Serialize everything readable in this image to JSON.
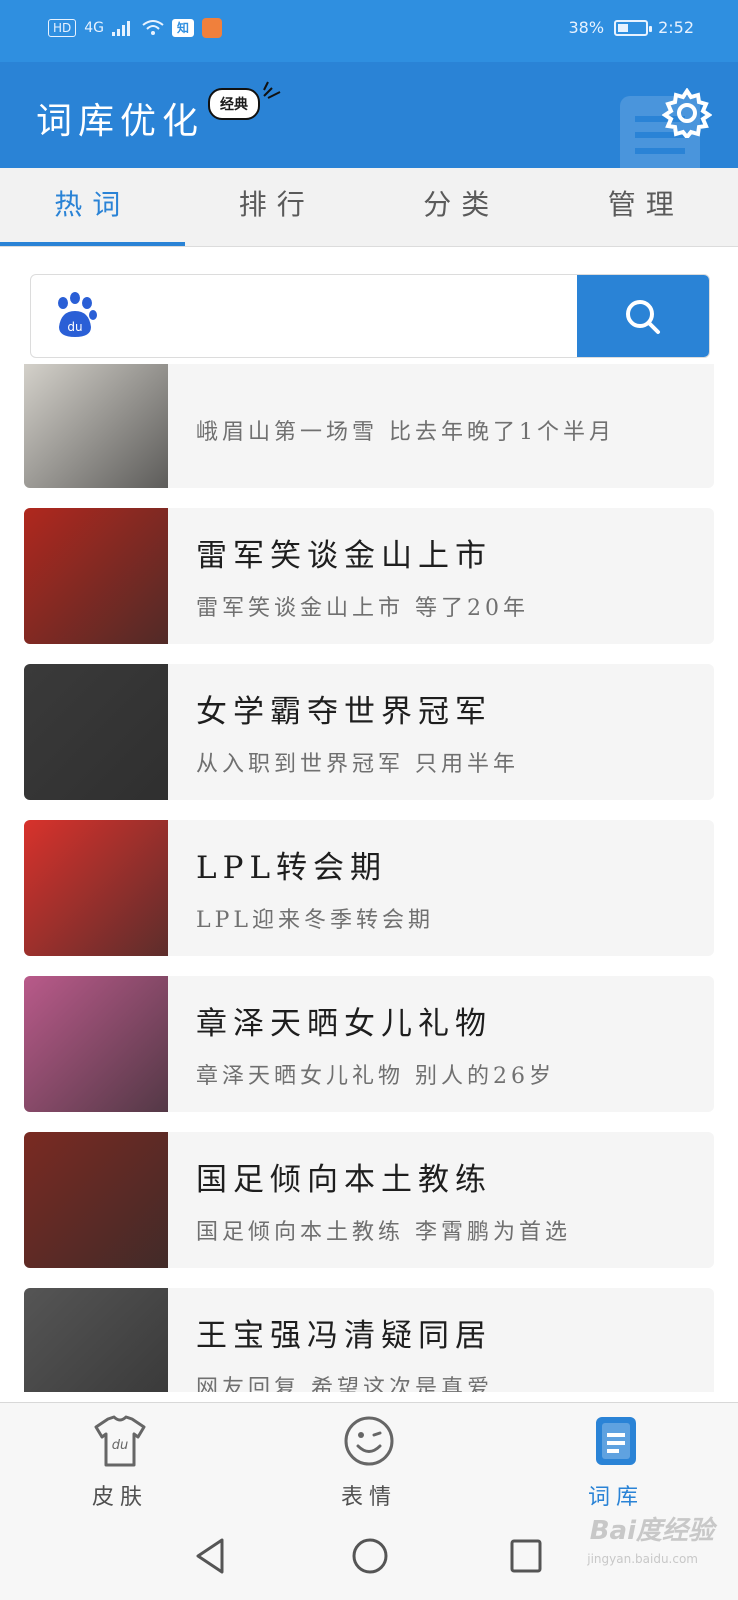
{
  "status_bar": {
    "hd": "HD",
    "network": "4G",
    "app_icon": "知",
    "battery": "38%",
    "battery_level": 0.38,
    "time": "2:52"
  },
  "header": {
    "title": "词库优化",
    "badge": "经典",
    "settings_icon": "gear-icon"
  },
  "tabs": [
    {
      "label": "热词",
      "active": true
    },
    {
      "label": "排行",
      "active": false
    },
    {
      "label": "分类",
      "active": false
    },
    {
      "label": "管理",
      "active": false
    }
  ],
  "search": {
    "placeholder": "",
    "value": "",
    "logo_icon": "baidu-paw-icon",
    "button_icon": "search-icon"
  },
  "feed": [
    {
      "title": "",
      "subtitle": "峨眉山第一场雪 比去年晚了1个半月",
      "thumb_color": "#d9d6cf"
    },
    {
      "title": "雷军笑谈金山上市",
      "subtitle": "雷军笑谈金山上市 等了20年",
      "thumb_color": "#b0281e"
    },
    {
      "title": "女学霸夺世界冠军",
      "subtitle": "从入职到世界冠军 只用半年",
      "thumb_color": "#3a3a3a"
    },
    {
      "title": "LPL转会期",
      "subtitle": "LPL迎来冬季转会期",
      "thumb_color": "#d8322c"
    },
    {
      "title": "章泽天晒女儿礼物",
      "subtitle": "章泽天晒女儿礼物 别人的26岁",
      "thumb_color": "#b95a8a"
    },
    {
      "title": "国足倾向本土教练",
      "subtitle": "国足倾向本土教练 李霄鹏为首选",
      "thumb_color": "#7a2a22"
    },
    {
      "title": "王宝强冯清疑同居",
      "subtitle": "网友回复 希望这次是真爱",
      "thumb_color": "#555555"
    }
  ],
  "bottom_nav": [
    {
      "label": "皮肤",
      "icon": "shirt-icon",
      "active": false
    },
    {
      "label": "表情",
      "icon": "smiley-icon",
      "active": false
    },
    {
      "label": "词库",
      "icon": "book-icon",
      "active": true
    }
  ],
  "watermark": "Bai度经验",
  "watermark_sub": "jingyan.baidu.com",
  "colors": {
    "primary": "#2a83d6",
    "status_bar": "#2f8fe0"
  }
}
